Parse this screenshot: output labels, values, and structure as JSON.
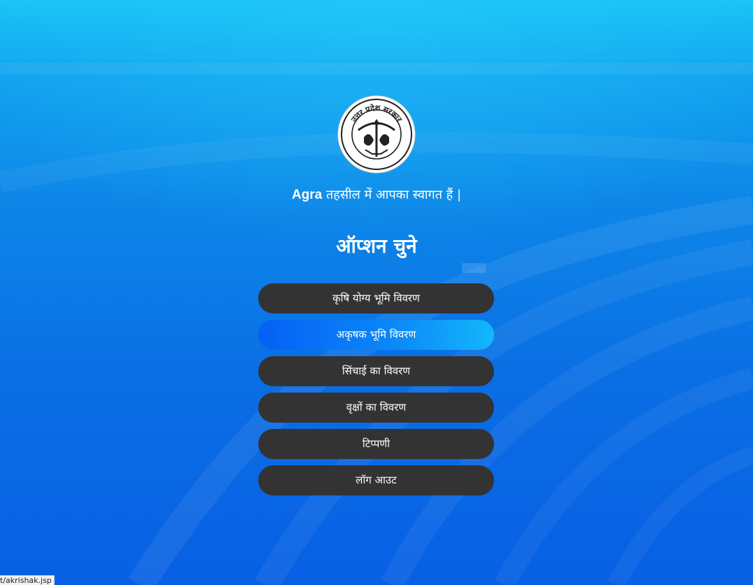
{
  "header": {
    "place": "Agra",
    "welcome_text": "तहसील में आपका स्वागत हैं |"
  },
  "emblem": {
    "icon": "up-government-emblem",
    "text": "उत्तर प्रदेश सरकार"
  },
  "page": {
    "heading": "ऑप्शन चुने"
  },
  "menu": {
    "items": [
      {
        "label": "कृषि योग्य भूमि विवरण",
        "active": false
      },
      {
        "label": "अकृषक भूमि विवरण",
        "active": true
      },
      {
        "label": "सिंचाई का विवरण",
        "active": false
      },
      {
        "label": "वृक्षों का विवरण",
        "active": false
      },
      {
        "label": "टिप्पणी",
        "active": false
      },
      {
        "label": "लॉग आउट",
        "active": false
      }
    ]
  },
  "status_bar": {
    "url": "t/akrishak.jsp"
  },
  "colors": {
    "button_default": "#333333",
    "button_active_start": "#0660f5",
    "button_active_end": "#13b7fb",
    "background_top": "#18c4f6",
    "background_bottom": "#0860e4"
  }
}
